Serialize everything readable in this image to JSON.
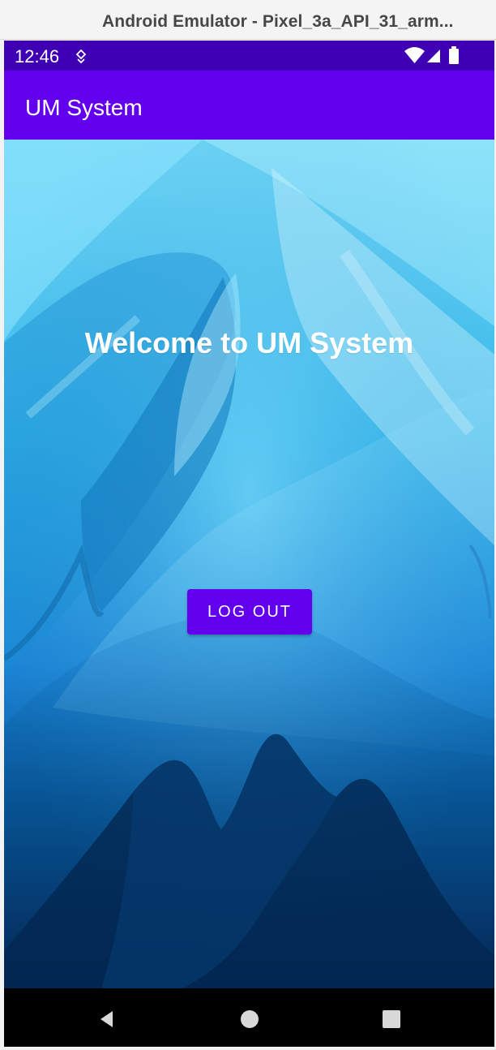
{
  "window": {
    "title": "Android Emulator - Pixel_3a_API_31_arm..."
  },
  "status_bar": {
    "time": "12:46",
    "icons": [
      "notification-icon",
      "wifi-icon",
      "signal-icon",
      "battery-icon"
    ],
    "background_color": "#3f00b4"
  },
  "app_bar": {
    "title": "UM System",
    "background_color": "#6200ee"
  },
  "main": {
    "welcome_text": "Welcome to UM System",
    "logout_label": "LOG OUT"
  },
  "navigation": {
    "items": [
      "back-icon",
      "home-icon",
      "recents-icon"
    ]
  }
}
